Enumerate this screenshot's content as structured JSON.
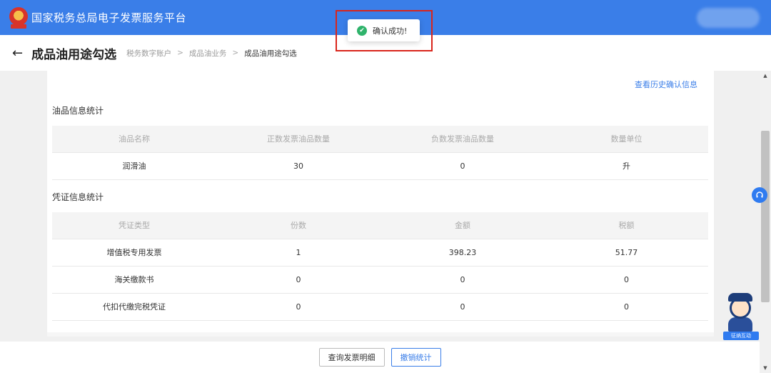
{
  "header": {
    "app_title": "国家税务总局电子发票服务平台",
    "emblem_icon": "tax-emblem-icon",
    "brand_color": "#3a7ee8"
  },
  "page": {
    "back_icon": "back-arrow-icon",
    "back_glyph": "←",
    "title": "成品油用途勾选",
    "breadcrumb": [
      "税务数字账户",
      "成品油业务",
      "成品油用途勾选"
    ],
    "separator": ">"
  },
  "content": {
    "history_link": "查看历史确认信息",
    "oil_section": {
      "title": "油品信息统计",
      "columns": [
        "油品名称",
        "正数发票油品数量",
        "负数发票油品数量",
        "数量单位"
      ],
      "rows": [
        [
          "润滑油",
          "30",
          "0",
          "升"
        ]
      ]
    },
    "voucher_section": {
      "title": "凭证信息统计",
      "columns": [
        "凭证类型",
        "份数",
        "金额",
        "税额"
      ],
      "rows": [
        [
          "增值税专用发票",
          "1",
          "398.23",
          "51.77"
        ],
        [
          "海关缴款书",
          "0",
          "0",
          "0"
        ],
        [
          "代扣代缴完税凭证",
          "0",
          "0",
          "0"
        ]
      ]
    }
  },
  "footer": {
    "query_button": "查询发票明细",
    "revoke_button": "撤销统计"
  },
  "toast": {
    "icon": "check-circle-icon",
    "glyph": "✔",
    "message": "确认成功!",
    "status_color": "#2fb36b",
    "highlight_color": "#d9251b"
  },
  "floating": {
    "service_icon": "headset-icon",
    "assistant_label": "征纳互动"
  },
  "scrollbar": {
    "up_glyph": "▲",
    "down_glyph": "▼"
  }
}
